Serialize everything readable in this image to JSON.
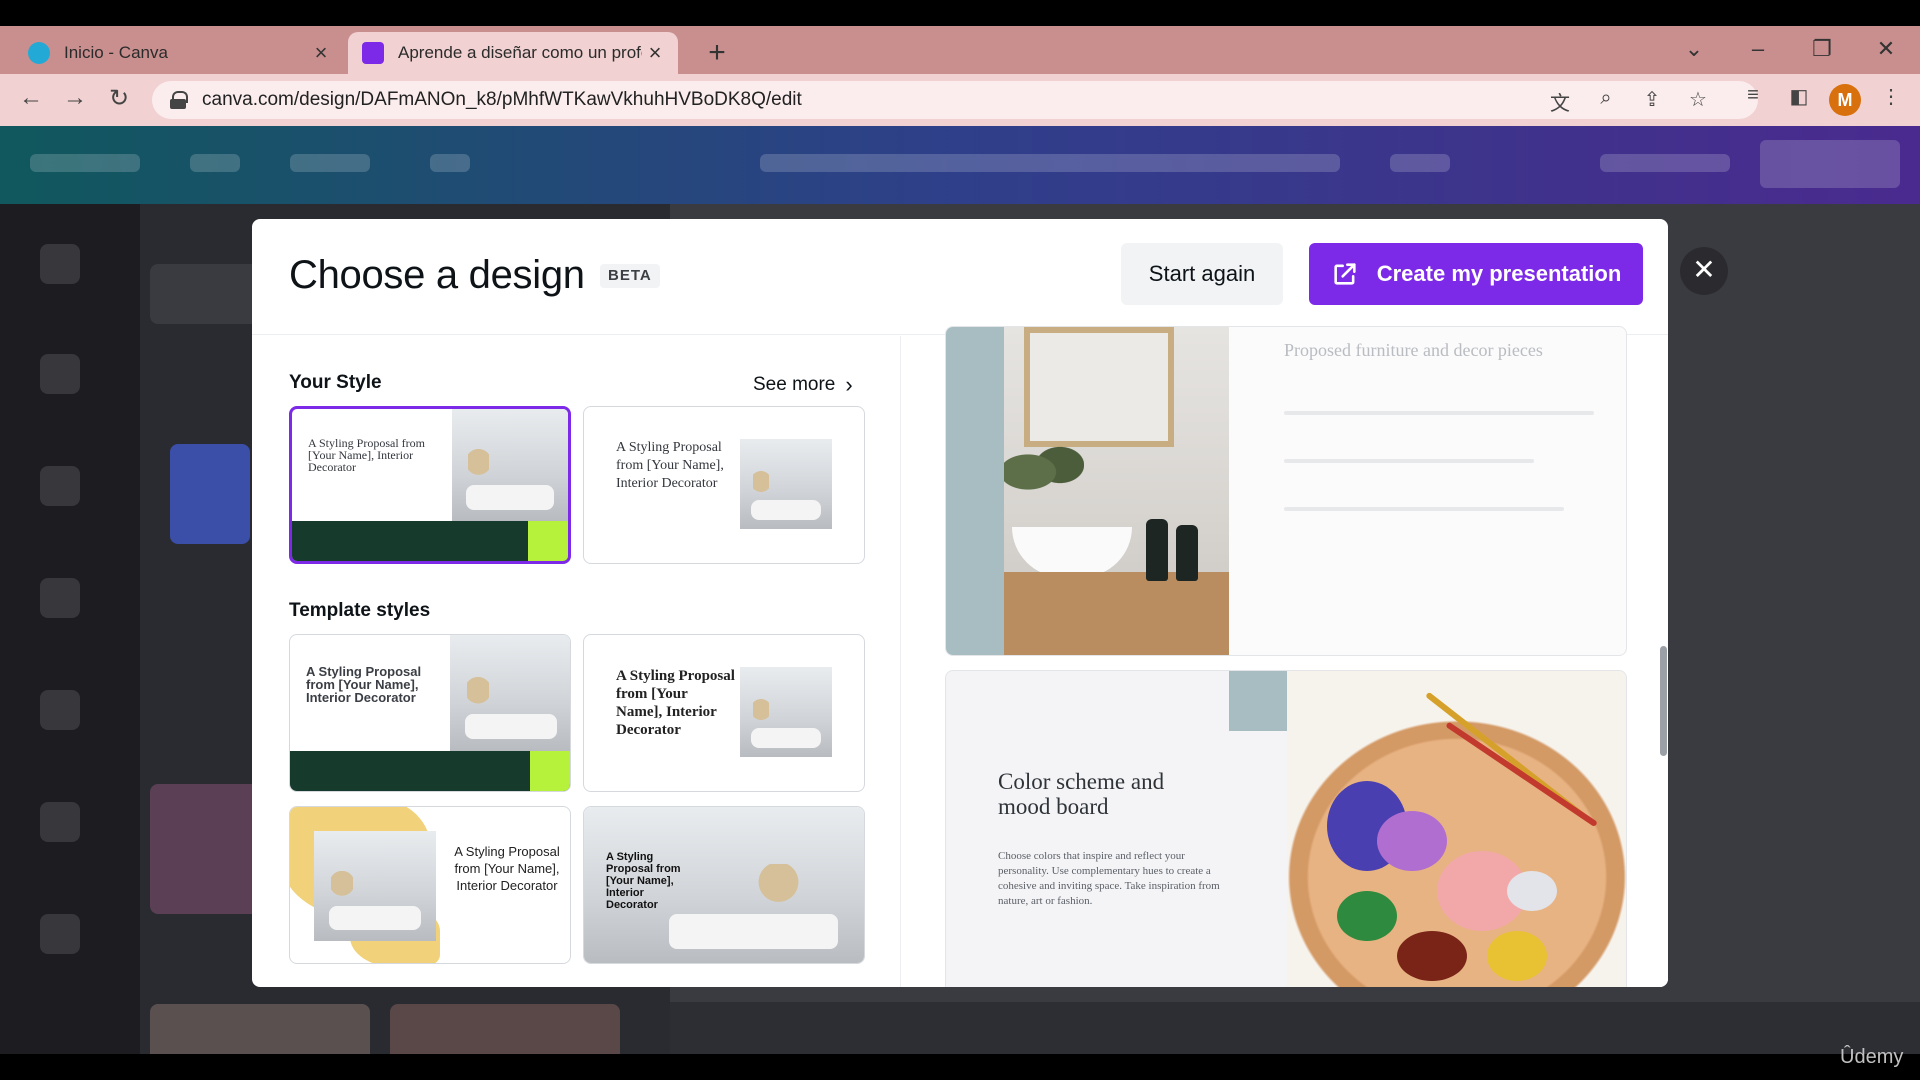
{
  "browser": {
    "tabs": [
      {
        "title": "Inicio - Canva",
        "favicon_color": "#23a9d6"
      },
      {
        "title": "Aprende a diseñar como un profesional con Canva",
        "favicon_color": "#7d2ae8"
      }
    ],
    "new_tab": "+",
    "url": "canva.com/design/DAFmANOn_k8/pMhfWTKawVkhuhHVBoDK8Q/edit",
    "profile_initial": "M"
  },
  "modal": {
    "title": "Choose a design",
    "badge": "BETA",
    "start_again": "Start again",
    "create": "Create my presentation",
    "close": "✕"
  },
  "your_style": {
    "label": "Your Style",
    "see_more": "See more",
    "cards": [
      {
        "text": "A Styling Proposal from [Your Name], Interior Decorator"
      },
      {
        "text": "A Styling Proposal from [Your Name], Interior Decorator"
      }
    ]
  },
  "template_styles": {
    "label": "Template styles",
    "cards": [
      {
        "text": "A Styling Proposal from [Your Name], Interior Decorator"
      },
      {
        "text": "A Styling Proposal from [Your Name], Interior Decorator"
      },
      {
        "text": "A Styling Proposal from [Your Name], Interior Decorator"
      },
      {
        "text": "A Styling Proposal from [Your Name], Interior Decorator"
      }
    ]
  },
  "preview": {
    "slide1_title": "Proposed furniture and decor pieces",
    "slide2_title": "Color scheme and mood board",
    "slide2_body": "Choose colors that inspire and reflect your personality. Use complementary hues to create a cohesive and inviting space. Take inspiration from nature, art or fashion."
  },
  "watermark": "Ûdemy",
  "colors": {
    "accent": "#7d2ae8",
    "tab_bar": "#c98f8f",
    "dark_green": "#163a2b",
    "lime": "#b6f23c"
  }
}
